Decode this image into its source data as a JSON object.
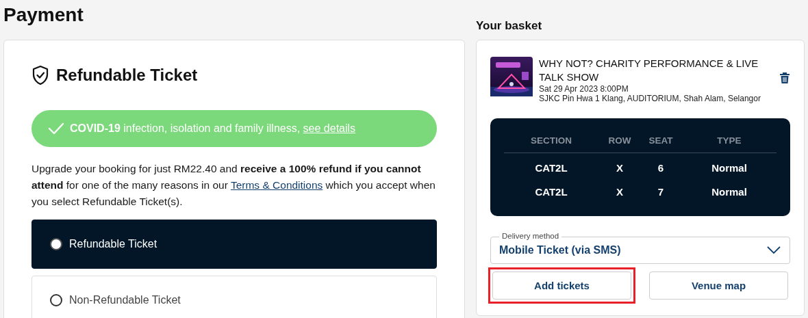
{
  "page_title": "Payment",
  "refund": {
    "title": "Refundable Ticket",
    "banner": {
      "text": "**COVID-19** infection, isolation and family illness, ",
      "link": "see details"
    },
    "description": {
      "before": "Upgrade your booking for just RM22.40 and **receive a 100% refund if you cannot attend** for one of the many reasons in our ",
      "link": "Terms & Conditions",
      "after": " which you accept when you select Refundable Ticket(s)."
    },
    "options": [
      {
        "label": "Refundable Ticket",
        "selected": true
      },
      {
        "label": "Non-Refundable Ticket",
        "selected": false
      }
    ]
  },
  "basket": {
    "title": "Your basket",
    "event": {
      "kind": "picture",
      "name": "WHY NOT? CHARITY PERFORMANCE & LIVE TALK SHOW",
      "date": "Sat 29 Apr 2023 8:00PM",
      "venue": "SJKC Pin Hwa 1 Klang, AUDITORIUM, Shah Alam, Selangor"
    },
    "seats": {
      "columns": [
        "SECTION",
        "ROW",
        "SEAT",
        "TYPE"
      ],
      "rows": [
        [
          "CAT2L",
          "X",
          "6",
          "Normal"
        ],
        [
          "CAT2L",
          "X",
          "7",
          "Normal"
        ]
      ]
    },
    "delivery": {
      "label": "Delivery method",
      "value": "Mobile Ticket (via SMS)"
    },
    "buttons": [
      {
        "label": "Add tickets",
        "highlighted": true
      },
      {
        "label": "Venue map",
        "highlighted": false
      }
    ]
  }
}
